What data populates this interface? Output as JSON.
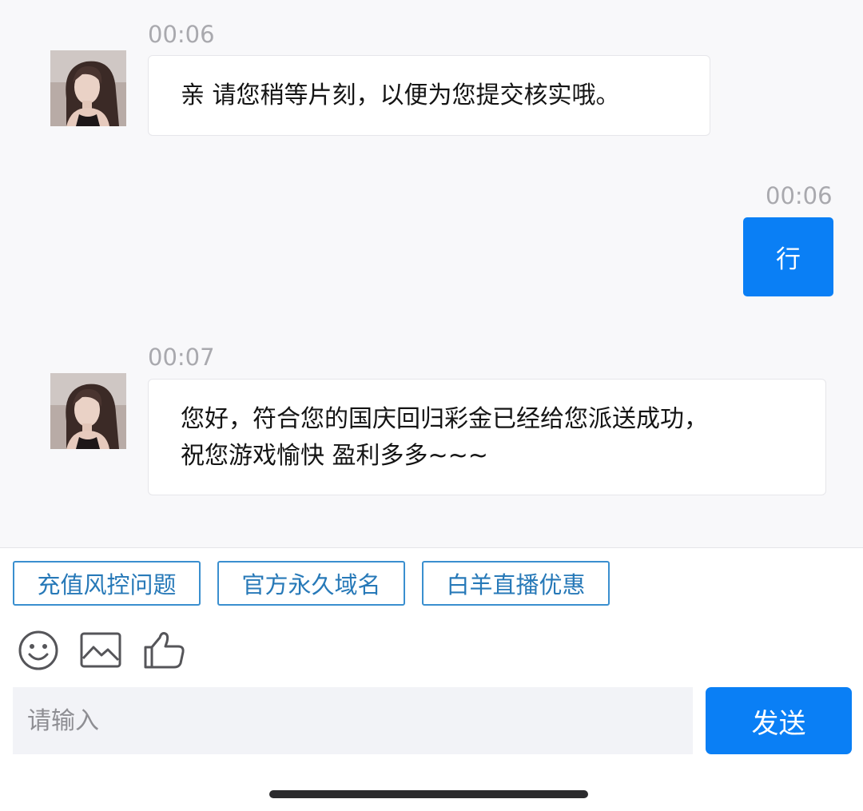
{
  "messages": [
    {
      "direction": "incoming",
      "time": "00:06",
      "text": "亲 请您稍等片刻，以便为您提交核实哦。"
    },
    {
      "direction": "outgoing",
      "time": "00:06",
      "text": "行"
    },
    {
      "direction": "incoming",
      "time": "00:07",
      "lines": [
        "您好，符合您的国庆回归彩金已经给您派送成功，",
        "祝您游戏愉快 盈利多多~~~"
      ]
    }
  ],
  "quick_replies": [
    "充值风控问题",
    "官方永久域名",
    "白羊直播优惠"
  ],
  "toolbar": {
    "icons": [
      "emoji-icon",
      "image-icon",
      "thumbs-up-icon"
    ]
  },
  "input": {
    "placeholder": "请输入",
    "value": ""
  },
  "send_label": "发送",
  "colors": {
    "accent": "#0a7ff5",
    "quick_reply_border": "#3a8fcf",
    "chat_background": "#f8f8fa",
    "input_background": "#f2f3f7"
  }
}
